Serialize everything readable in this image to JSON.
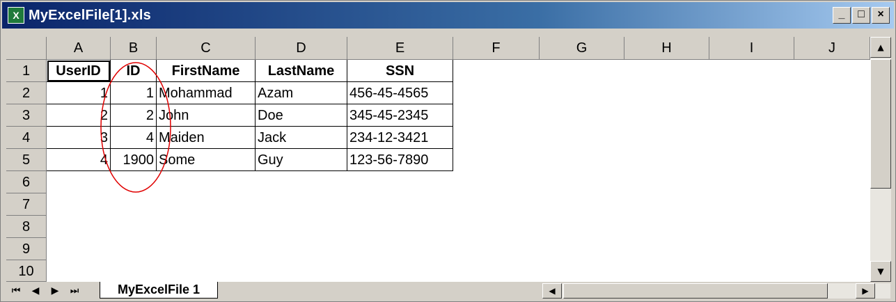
{
  "window": {
    "title": "MyExcelFile[1].xls",
    "icon": "excel-icon",
    "controls": [
      "_",
      "□",
      "×"
    ]
  },
  "columns": [
    "A",
    "B",
    "C",
    "D",
    "E",
    "F",
    "G",
    "H",
    "I",
    "J"
  ],
  "rows": [
    "1",
    "2",
    "3",
    "4",
    "5",
    "6",
    "7",
    "8",
    "9",
    "10"
  ],
  "table": {
    "headers": [
      "UserID",
      "ID",
      "FirstName",
      "LastName",
      "SSN"
    ],
    "rows": [
      [
        "1",
        "1",
        "Mohammad",
        "Azam",
        "456-45-4565"
      ],
      [
        "2",
        "2",
        "John",
        "Doe",
        "345-45-2345"
      ],
      [
        "3",
        "4",
        "Maiden",
        "Jack",
        "234-12-3421"
      ],
      [
        "4",
        "1900",
        "Some",
        "Guy",
        "123-56-7890"
      ]
    ]
  },
  "sheet_tab": "MyExcelFile 1",
  "nav": {
    "first": "⏮",
    "prev": "◀",
    "next": "▶",
    "last": "⏭"
  },
  "scroll": {
    "up": "▲",
    "down": "▼",
    "left": "◀",
    "right": "▶"
  },
  "annotation": {
    "shape": "red-ellipse",
    "color": "#ff0000"
  }
}
